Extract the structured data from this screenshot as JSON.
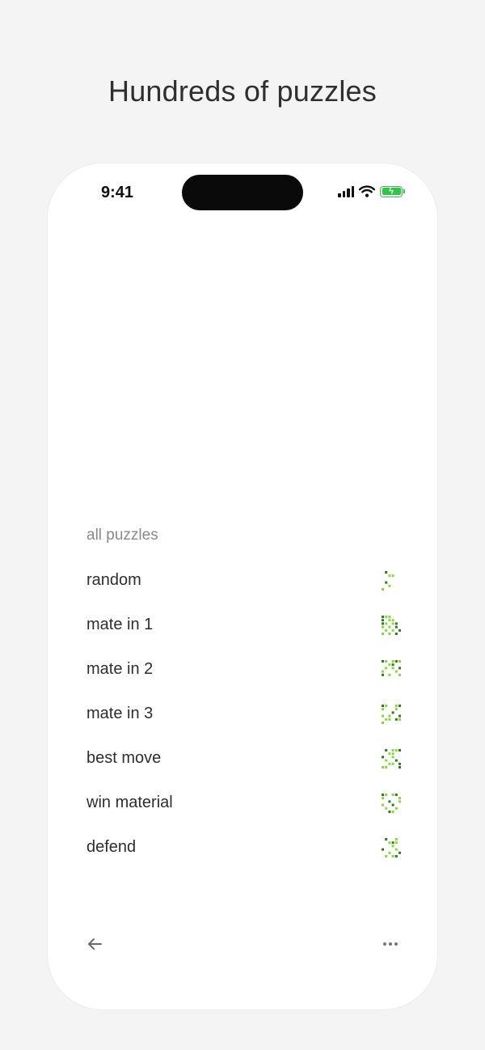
{
  "headline": "Hundreds of puzzles",
  "status_bar": {
    "time": "9:41",
    "icons": [
      "cellular-signal-icon",
      "wifi-icon",
      "battery-charging-icon"
    ],
    "battery_color": "#35c24a"
  },
  "puzzles": {
    "header": "all puzzles",
    "items": [
      {
        "label": "random",
        "icon": "puzzle-thumbnail-icon"
      },
      {
        "label": "mate in 1",
        "icon": "puzzle-thumbnail-icon"
      },
      {
        "label": "mate in 2",
        "icon": "puzzle-thumbnail-icon"
      },
      {
        "label": "mate in 3",
        "icon": "puzzle-thumbnail-icon"
      },
      {
        "label": "best move",
        "icon": "puzzle-thumbnail-icon"
      },
      {
        "label": "win material",
        "icon": "puzzle-thumbnail-icon"
      },
      {
        "label": "defend",
        "icon": "puzzle-thumbnail-icon"
      }
    ]
  },
  "bottom_bar": {
    "back_icon": "arrow-left-icon",
    "more_icon": "more-horizontal-icon"
  },
  "colors": {
    "background": "#f4f4f4",
    "phone": "#ffffff",
    "accent_green": "#35c24a",
    "thumbnail_light": "#8bd44a",
    "thumbnail_dark": "#2f7a1f"
  }
}
